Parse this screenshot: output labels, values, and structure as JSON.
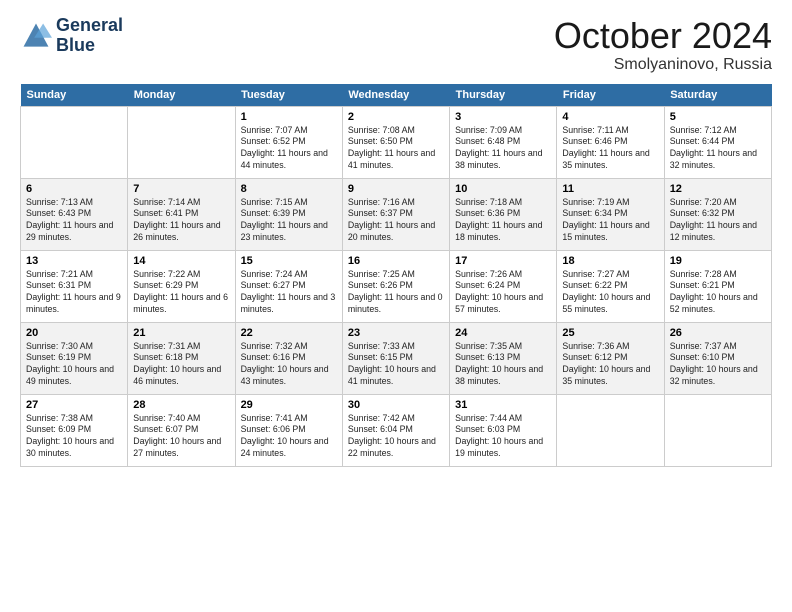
{
  "header": {
    "logo_line1": "General",
    "logo_line2": "Blue",
    "month": "October 2024",
    "location": "Smolyaninovo, Russia"
  },
  "weekdays": [
    "Sunday",
    "Monday",
    "Tuesday",
    "Wednesday",
    "Thursday",
    "Friday",
    "Saturday"
  ],
  "weeks": [
    [
      {
        "day": "",
        "empty": true
      },
      {
        "day": "",
        "empty": true
      },
      {
        "day": "1",
        "sunrise": "7:07 AM",
        "sunset": "6:52 PM",
        "daylight": "11 hours and 44 minutes."
      },
      {
        "day": "2",
        "sunrise": "7:08 AM",
        "sunset": "6:50 PM",
        "daylight": "11 hours and 41 minutes."
      },
      {
        "day": "3",
        "sunrise": "7:09 AM",
        "sunset": "6:48 PM",
        "daylight": "11 hours and 38 minutes."
      },
      {
        "day": "4",
        "sunrise": "7:11 AM",
        "sunset": "6:46 PM",
        "daylight": "11 hours and 35 minutes."
      },
      {
        "day": "5",
        "sunrise": "7:12 AM",
        "sunset": "6:44 PM",
        "daylight": "11 hours and 32 minutes."
      }
    ],
    [
      {
        "day": "6",
        "sunrise": "7:13 AM",
        "sunset": "6:43 PM",
        "daylight": "11 hours and 29 minutes."
      },
      {
        "day": "7",
        "sunrise": "7:14 AM",
        "sunset": "6:41 PM",
        "daylight": "11 hours and 26 minutes."
      },
      {
        "day": "8",
        "sunrise": "7:15 AM",
        "sunset": "6:39 PM",
        "daylight": "11 hours and 23 minutes."
      },
      {
        "day": "9",
        "sunrise": "7:16 AM",
        "sunset": "6:37 PM",
        "daylight": "11 hours and 20 minutes."
      },
      {
        "day": "10",
        "sunrise": "7:18 AM",
        "sunset": "6:36 PM",
        "daylight": "11 hours and 18 minutes."
      },
      {
        "day": "11",
        "sunrise": "7:19 AM",
        "sunset": "6:34 PM",
        "daylight": "11 hours and 15 minutes."
      },
      {
        "day": "12",
        "sunrise": "7:20 AM",
        "sunset": "6:32 PM",
        "daylight": "11 hours and 12 minutes."
      }
    ],
    [
      {
        "day": "13",
        "sunrise": "7:21 AM",
        "sunset": "6:31 PM",
        "daylight": "11 hours and 9 minutes."
      },
      {
        "day": "14",
        "sunrise": "7:22 AM",
        "sunset": "6:29 PM",
        "daylight": "11 hours and 6 minutes."
      },
      {
        "day": "15",
        "sunrise": "7:24 AM",
        "sunset": "6:27 PM",
        "daylight": "11 hours and 3 minutes."
      },
      {
        "day": "16",
        "sunrise": "7:25 AM",
        "sunset": "6:26 PM",
        "daylight": "11 hours and 0 minutes."
      },
      {
        "day": "17",
        "sunrise": "7:26 AM",
        "sunset": "6:24 PM",
        "daylight": "10 hours and 57 minutes."
      },
      {
        "day": "18",
        "sunrise": "7:27 AM",
        "sunset": "6:22 PM",
        "daylight": "10 hours and 55 minutes."
      },
      {
        "day": "19",
        "sunrise": "7:28 AM",
        "sunset": "6:21 PM",
        "daylight": "10 hours and 52 minutes."
      }
    ],
    [
      {
        "day": "20",
        "sunrise": "7:30 AM",
        "sunset": "6:19 PM",
        "daylight": "10 hours and 49 minutes."
      },
      {
        "day": "21",
        "sunrise": "7:31 AM",
        "sunset": "6:18 PM",
        "daylight": "10 hours and 46 minutes."
      },
      {
        "day": "22",
        "sunrise": "7:32 AM",
        "sunset": "6:16 PM",
        "daylight": "10 hours and 43 minutes."
      },
      {
        "day": "23",
        "sunrise": "7:33 AM",
        "sunset": "6:15 PM",
        "daylight": "10 hours and 41 minutes."
      },
      {
        "day": "24",
        "sunrise": "7:35 AM",
        "sunset": "6:13 PM",
        "daylight": "10 hours and 38 minutes."
      },
      {
        "day": "25",
        "sunrise": "7:36 AM",
        "sunset": "6:12 PM",
        "daylight": "10 hours and 35 minutes."
      },
      {
        "day": "26",
        "sunrise": "7:37 AM",
        "sunset": "6:10 PM",
        "daylight": "10 hours and 32 minutes."
      }
    ],
    [
      {
        "day": "27",
        "sunrise": "7:38 AM",
        "sunset": "6:09 PM",
        "daylight": "10 hours and 30 minutes."
      },
      {
        "day": "28",
        "sunrise": "7:40 AM",
        "sunset": "6:07 PM",
        "daylight": "10 hours and 27 minutes."
      },
      {
        "day": "29",
        "sunrise": "7:41 AM",
        "sunset": "6:06 PM",
        "daylight": "10 hours and 24 minutes."
      },
      {
        "day": "30",
        "sunrise": "7:42 AM",
        "sunset": "6:04 PM",
        "daylight": "10 hours and 22 minutes."
      },
      {
        "day": "31",
        "sunrise": "7:44 AM",
        "sunset": "6:03 PM",
        "daylight": "10 hours and 19 minutes."
      },
      {
        "day": "",
        "empty": true
      },
      {
        "day": "",
        "empty": true
      }
    ]
  ]
}
